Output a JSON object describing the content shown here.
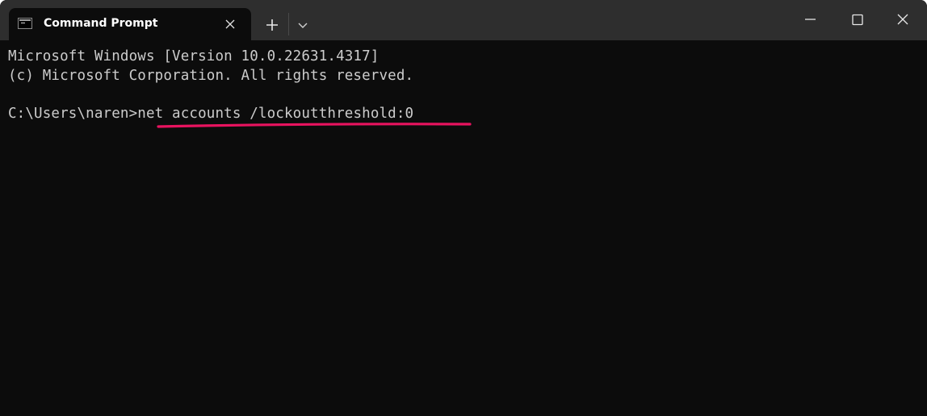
{
  "window": {
    "tab_title": "Command Prompt",
    "icons": {
      "tab": "command-prompt-icon",
      "tab_close": "close-icon",
      "new_tab": "plus-icon",
      "dropdown": "chevron-down-icon",
      "minimize": "minimize-icon",
      "maximize": "maximize-icon",
      "close": "close-icon"
    }
  },
  "console": {
    "lines": [
      "Microsoft Windows [Version 10.0.22631.4317]",
      "(c) Microsoft Corporation. All rights reserved.",
      "",
      "C:\\Users\\naren>net accounts /lockoutthreshold:0"
    ],
    "prompt": "C:\\Users\\naren>",
    "command": "net accounts /lockoutthreshold:0"
  },
  "annotation": {
    "underline_color": "#e8135f"
  }
}
